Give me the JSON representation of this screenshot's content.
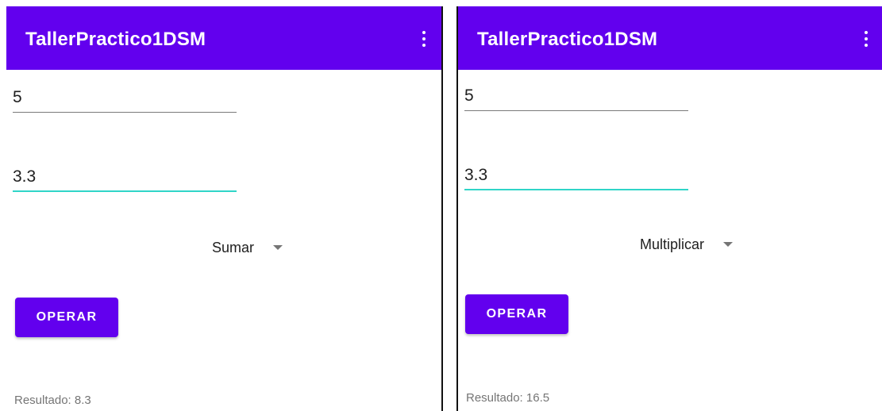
{
  "colors": {
    "primary": "#6200ee",
    "accent": "#30d5c8",
    "on_primary": "#ffffff"
  },
  "screens": [
    {
      "app_title": "TallerPractico1DSM",
      "overflow_icon": "more-vert-icon",
      "first_number": "5",
      "second_number": "3.3",
      "operation": "Sumar",
      "button_label": "OPERAR",
      "result": "Resultado: 8.3"
    },
    {
      "app_title": "TallerPractico1DSM",
      "overflow_icon": "more-vert-icon",
      "first_number": "5",
      "second_number": "3.3",
      "operation": "Multiplicar",
      "button_label": "OPERAR",
      "result": "Resultado: 16.5"
    }
  ]
}
